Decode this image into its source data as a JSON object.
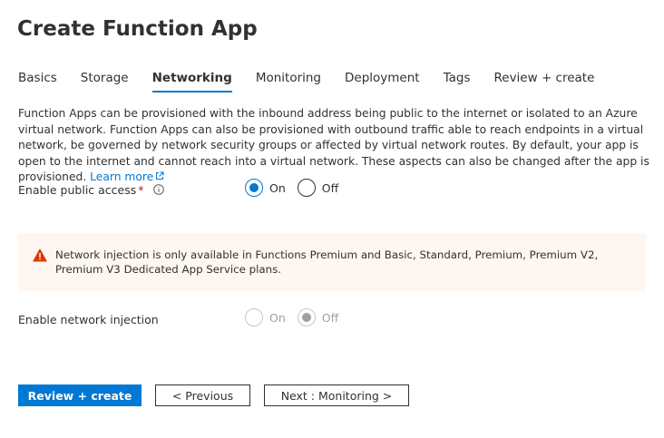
{
  "page": {
    "title": "Create Function App"
  },
  "tabs": [
    {
      "label": "Basics"
    },
    {
      "label": "Storage"
    },
    {
      "label": "Networking",
      "active": true
    },
    {
      "label": "Monitoring"
    },
    {
      "label": "Deployment"
    },
    {
      "label": "Tags"
    },
    {
      "label": "Review + create"
    }
  ],
  "description": {
    "text": "Function Apps can be provisioned with the inbound address being public to the internet or isolated to an Azure virtual network. Function Apps can also be provisioned with outbound traffic able to reach endpoints in a virtual network, be governed by network security groups or affected by virtual network routes. By default, your app is open to the internet and cannot reach into a virtual network. These aspects can also be changed after the app is provisioned.",
    "link_label": "Learn more",
    "link_icon": "external-link-icon"
  },
  "public_access": {
    "label": "Enable public access",
    "required_mark": "*",
    "info_icon": "info-icon",
    "options": [
      {
        "label": "On",
        "checked": true
      },
      {
        "label": "Off",
        "checked": false
      }
    ]
  },
  "banner": {
    "icon": "warning-icon",
    "text": "Network injection is only available in Functions Premium and Basic, Standard, Premium, Premium V2, Premium V3 Dedicated App Service plans."
  },
  "network_injection": {
    "label": "Enable network injection",
    "disabled": true,
    "options": [
      {
        "label": "On",
        "checked": false
      },
      {
        "label": "Off",
        "checked": true
      }
    ]
  },
  "footer": {
    "review_create_label": "Review + create",
    "previous_label": "< Previous",
    "next_label": "Next : Monitoring >"
  },
  "colors": {
    "accent": "#0078d4",
    "warning": "#d83b01",
    "banner_bg": "#fdf6f1",
    "required": "#a4262c"
  }
}
